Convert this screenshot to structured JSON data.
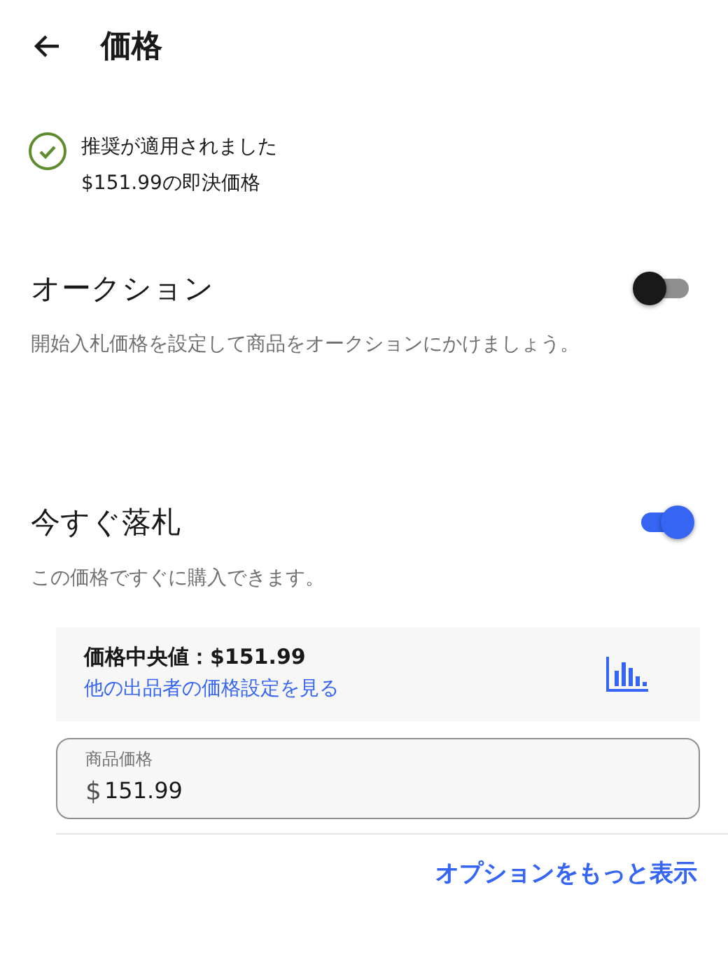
{
  "header": {
    "title": "価格"
  },
  "notice": {
    "lines": [
      "推奨が適用されました",
      "$151.99の即決価格"
    ]
  },
  "options": [
    {
      "title": "オークション",
      "description": "開始入札価格を設定して商品をオークションにかけましょう。",
      "on": false
    },
    {
      "title": "今すぐ落札",
      "description": "この価格ですぐに購入できます。",
      "on": true
    }
  ],
  "median": {
    "text": "価格中央値：$151.99",
    "link": "他の出品者の価格設定を見る"
  },
  "price_field": {
    "label": "商品価格",
    "prefix": "$",
    "value": "151.99"
  },
  "more_link": "オプションをもっと表示"
}
